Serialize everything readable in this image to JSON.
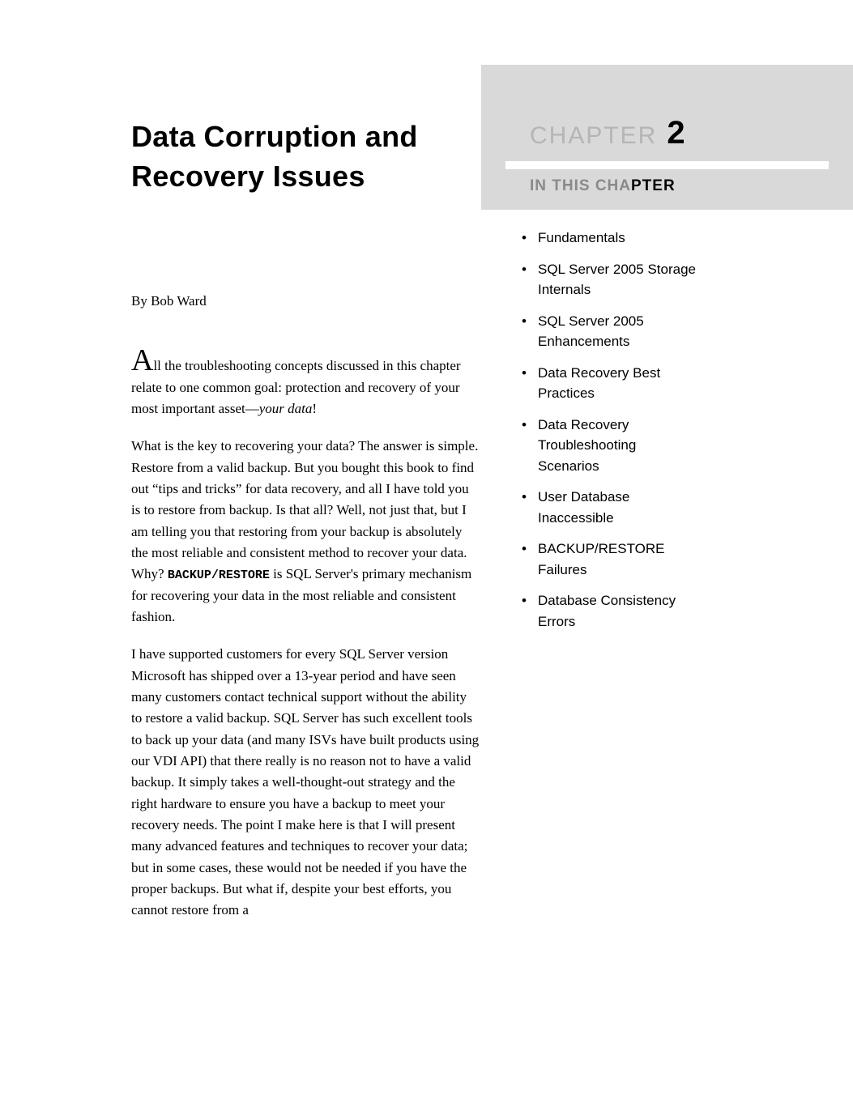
{
  "chapter": {
    "title": "Data Corruption and Recovery Issues",
    "label": "CHAPTER",
    "number": "2",
    "byline": "By Bob Ward"
  },
  "in_this_chapter": {
    "prefix": "IN THIS CHA",
    "suffix": "PTER",
    "items": [
      "Fundamentals",
      "SQL Server 2005 Storage Internals",
      "SQL Server 2005 Enhancements",
      "Data Recovery Best Practices",
      "Data Recovery Troubleshooting Scenarios",
      "User Database Inaccessible",
      "BACKUP/RESTORE Failures",
      "Database Consistency Errors"
    ]
  },
  "body": {
    "dropcap": "A",
    "intro_rest": "ll the troubleshooting concepts discussed in this chapter relate to one common goal: protection and recovery of your most important asset—",
    "intro_em": "your data",
    "intro_end": "!",
    "p2_a": "What is the key to recovering your data? The answer is simple. Restore from a valid backup. But you bought this book to find out “tips and tricks” for data recovery, and all I have told you is to restore from backup. Is that all? Well, not just that, but I am telling you that restoring from your backup is absolutely the most reliable and consistent method to recover your data. Why? ",
    "p2_mono": "BACKUP/RESTORE",
    "p2_b": " is SQL Server's primary mechanism for recovering your data in the most reliable and consistent fashion.",
    "p3": "I have supported customers for every SQL Server version Microsoft has shipped over a 13-year period and have seen many customers contact technical support without the ability to restore a valid backup. SQL Server has such excellent tools to back up your data (and many ISVs have built products using our VDI API) that there really is no reason not to have a valid backup. It simply takes a well-thought-out strategy and the right hardware to ensure you have a backup to meet your recovery needs. The point I make here is that I will present many advanced features and techniques to recover your data; but in some cases, these would not be needed if you have the proper backups. But what if, despite your best efforts, you cannot restore from a"
  }
}
